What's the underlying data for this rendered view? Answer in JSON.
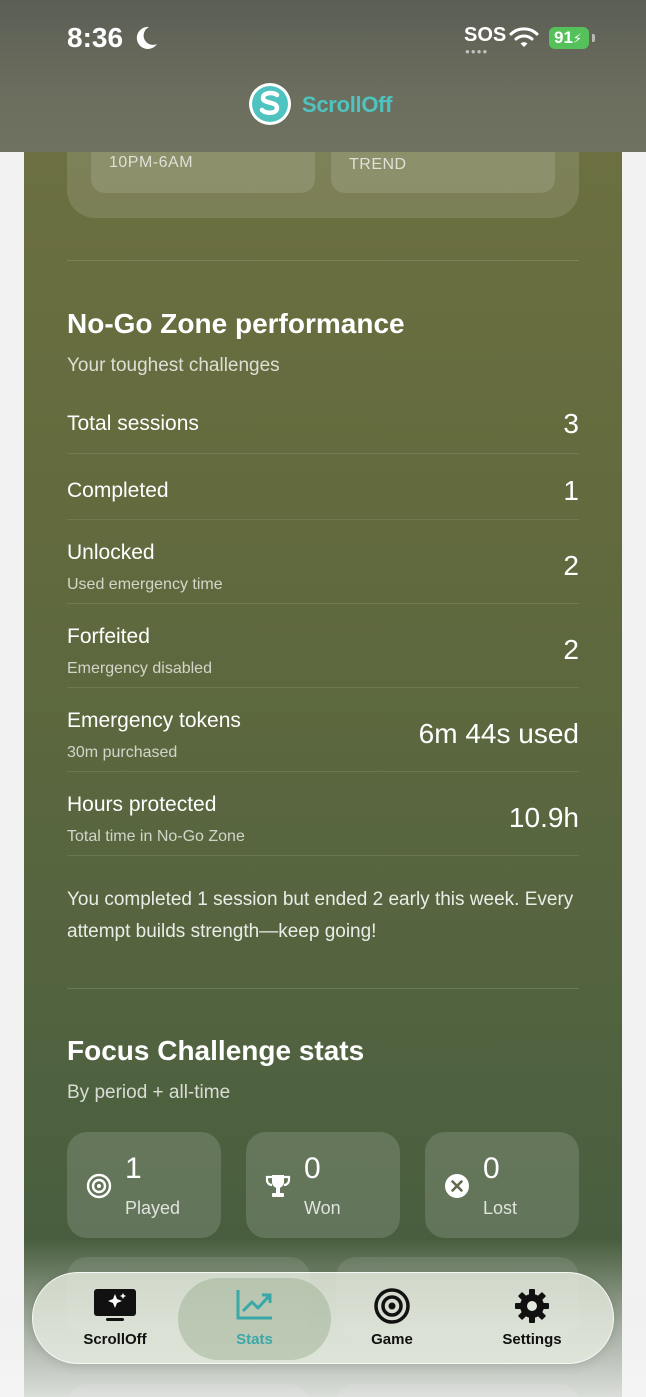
{
  "status_bar": {
    "time": "8:36",
    "carrier": "SOS",
    "battery": "91"
  },
  "header": {
    "brand": "ScrollOff"
  },
  "top_card": {
    "left_chip": "10PM-6AM",
    "right_chip": "TREND"
  },
  "nogo": {
    "title": "No-Go Zone performance",
    "subtitle": "Your toughest challenges",
    "rows": [
      {
        "label": "Total sessions",
        "sub": "",
        "value": "3"
      },
      {
        "label": "Completed",
        "sub": "",
        "value": "1"
      },
      {
        "label": "Unlocked",
        "sub": "Used emergency time",
        "value": "2"
      },
      {
        "label": "Forfeited",
        "sub": "Emergency disabled",
        "value": "2"
      },
      {
        "label": "Emergency tokens",
        "sub": "30m purchased",
        "value": "6m 44s used"
      },
      {
        "label": "Hours protected",
        "sub": "Total time in No-Go Zone",
        "value": "10.9h"
      }
    ],
    "note": "You completed 1 session but ended 2 early this week. Every attempt builds strength—keep going!"
  },
  "focus": {
    "title": "Focus Challenge stats",
    "subtitle": "By period + all-time",
    "cards": [
      {
        "icon": "target-icon",
        "value": "1",
        "label": "Played"
      },
      {
        "icon": "trophy-icon",
        "value": "0",
        "label": "Won"
      },
      {
        "icon": "x-circle-icon",
        "value": "0",
        "label": "Lost"
      }
    ]
  },
  "tabs": [
    {
      "label": "ScrollOff",
      "icon": "scrolloff-screen-icon",
      "active": false
    },
    {
      "label": "Stats",
      "icon": "chart-icon",
      "active": true
    },
    {
      "label": "Game",
      "icon": "target-icon",
      "active": false
    },
    {
      "label": "Settings",
      "icon": "gear-icon",
      "active": false
    }
  ],
  "colors": {
    "brand": "#4fc3c0",
    "battery": "#55c15a",
    "panel_top": "#6c7040",
    "panel_bottom": "#445a3e"
  }
}
